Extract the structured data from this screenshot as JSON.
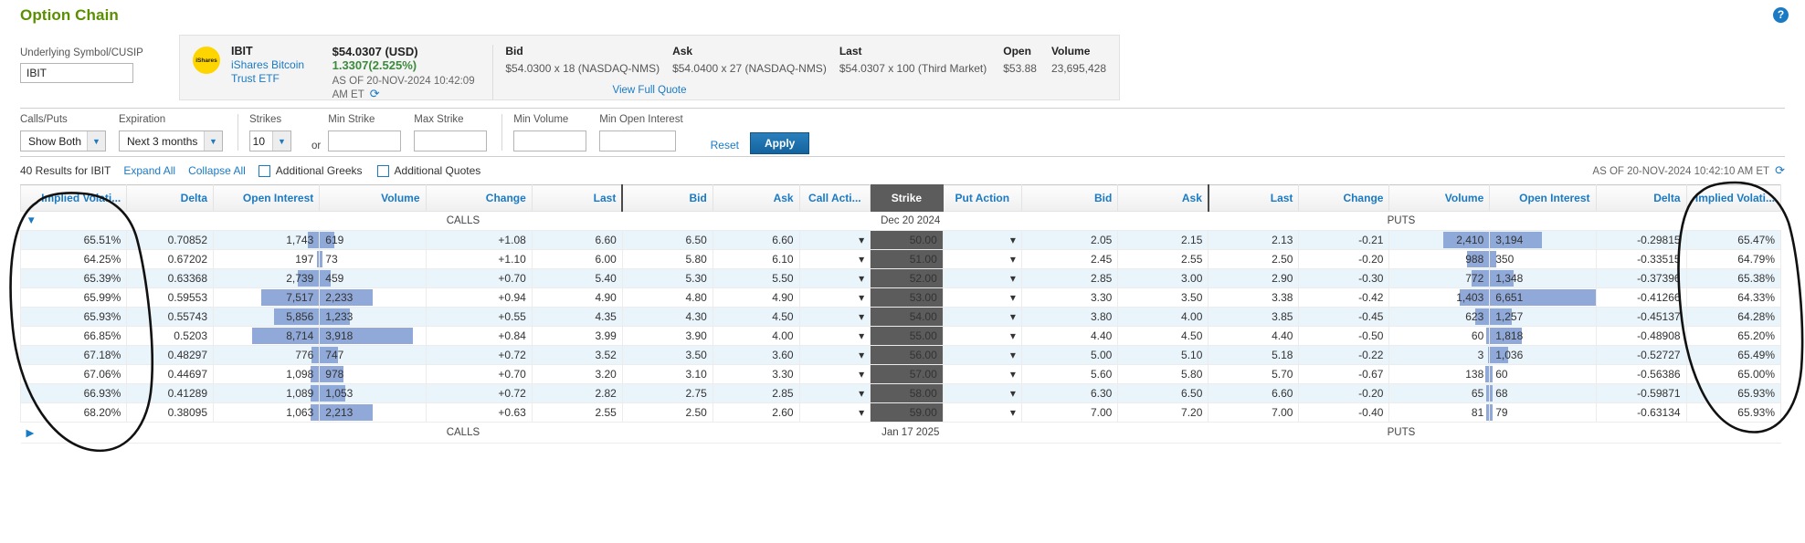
{
  "header": {
    "title": "Option Chain",
    "help_icon": "question-mark-icon"
  },
  "symbol": {
    "label": "Underlying Symbol/CUSIP",
    "value": "IBIT",
    "placeholder": ""
  },
  "quote": {
    "logo_text": "iShares",
    "ticker": "IBIT",
    "description": "iShares Bitcoin Trust ETF",
    "price": "$54.0307 (USD)",
    "change": "1.3307(2.525%)",
    "as_of": "AS OF 20-NOV-2024  10:42:09 AM ET",
    "refresh_icon": "refresh-icon",
    "bid_label": "Bid",
    "bid_value": "$54.0300 x 18 (NASDAQ-NMS)",
    "ask_label": "Ask",
    "ask_value": "$54.0400 x 27 (NASDAQ-NMS)",
    "last_label": "Last",
    "last_value": "$54.0307 x 100 (Third Market)",
    "open_label": "Open",
    "open_value": "$53.88",
    "volume_label": "Volume",
    "volume_value": "23,695,428",
    "full_quote_link": "View Full Quote"
  },
  "filters": {
    "calls_puts_label": "Calls/Puts",
    "calls_puts_value": "Show Both",
    "expiration_label": "Expiration",
    "expiration_value": "Next 3 months",
    "strikes_label": "Strikes",
    "strikes_value": "10",
    "or_text": "or",
    "min_strike_label": "Min Strike",
    "min_strike_value": "",
    "max_strike_label": "Max Strike",
    "max_strike_value": "",
    "min_volume_label": "Min Volume",
    "min_volume_value": "",
    "min_open_interest_label": "Min Open Interest",
    "min_open_interest_value": "",
    "reset_label": "Reset",
    "apply_label": "Apply"
  },
  "results": {
    "count_text": "40 Results for IBIT",
    "expand_all": "Expand All",
    "collapse_all": "Collapse All",
    "additional_greeks": "Additional Greeks",
    "additional_quotes": "Additional Quotes",
    "as_of": "AS OF 20-NOV-2024  10:42:10 AM ET",
    "refresh_icon": "refresh-icon"
  },
  "table": {
    "columns": [
      "Implied Volati...",
      "Delta",
      "Open Interest",
      "Volume",
      "Change",
      "Last",
      "Bid",
      "Ask",
      "Call Acti...",
      "Strike",
      "Put Action",
      "Bid",
      "Ask",
      "Last",
      "Change",
      "Volume",
      "Open Interest",
      "Delta",
      "Implied Volati..."
    ],
    "groups": [
      {
        "twisty": "collapse-triangle-icon",
        "calls_label": "CALLS",
        "expiration": "Dec 20 2024",
        "puts_label": "PUTS",
        "expanded": true
      },
      {
        "twisty": "expand-triangle-icon",
        "calls_label": "CALLS",
        "expiration": "Jan 17 2025",
        "puts_label": "PUTS",
        "expanded": false
      }
    ],
    "rows": [
      {
        "c_iv": "65.51%",
        "c_delta": "0.70852",
        "c_oi": "1,743",
        "c_vol": "619",
        "c_chg": "+1.08",
        "c_last": "6.60",
        "c_bid": "6.50",
        "c_ask": "6.60",
        "strike": "50.00",
        "p_bid": "2.05",
        "p_ask": "2.15",
        "p_last": "2.13",
        "p_chg": "-0.21",
        "p_vol": "2,410",
        "p_oi": "3,194",
        "p_delta": "-0.29815",
        "p_iv": "65.47%",
        "c_oi_bar": 11,
        "c_vol_bar": 14,
        "p_vol_bar": 46,
        "p_oi_bar": 49
      },
      {
        "c_iv": "64.25%",
        "c_delta": "0.67202",
        "c_oi": "197",
        "c_vol": "73",
        "c_chg": "+1.10",
        "c_last": "6.00",
        "c_bid": "5.80",
        "c_ask": "6.10",
        "strike": "51.00",
        "p_bid": "2.45",
        "p_ask": "2.55",
        "p_last": "2.50",
        "p_chg": "-0.20",
        "p_vol": "988",
        "p_oi": "350",
        "p_delta": "-0.33515",
        "p_iv": "64.79%",
        "c_oi_bar": 2,
        "c_vol_bar": 2,
        "p_vol_bar": 22,
        "p_oi_bar": 6
      },
      {
        "c_iv": "65.39%",
        "c_delta": "0.63368",
        "c_oi": "2,739",
        "c_vol": "459",
        "c_chg": "+0.70",
        "c_last": "5.40",
        "c_bid": "5.30",
        "c_ask": "5.50",
        "strike": "52.00",
        "p_bid": "2.85",
        "p_ask": "3.00",
        "p_last": "2.90",
        "p_chg": "-0.30",
        "p_vol": "772",
        "p_oi": "1,348",
        "p_delta": "-0.37396",
        "p_iv": "65.38%",
        "c_oi_bar": 20,
        "c_vol_bar": 10,
        "p_vol_bar": 18,
        "p_oi_bar": 22
      },
      {
        "c_iv": "65.99%",
        "c_delta": "0.59553",
        "c_oi": "7,517",
        "c_vol": "2,233",
        "c_chg": "+0.94",
        "c_last": "4.90",
        "c_bid": "4.80",
        "c_ask": "4.90",
        "strike": "53.00",
        "p_bid": "3.30",
        "p_ask": "3.50",
        "p_last": "3.38",
        "p_chg": "-0.42",
        "p_vol": "1,403",
        "p_oi": "6,651",
        "p_delta": "-0.41266",
        "p_iv": "64.33%",
        "c_oi_bar": 55,
        "c_vol_bar": 50,
        "p_vol_bar": 30,
        "p_oi_bar": 100
      },
      {
        "c_iv": "65.93%",
        "c_delta": "0.55743",
        "c_oi": "5,856",
        "c_vol": "1,233",
        "c_chg": "+0.55",
        "c_last": "4.35",
        "c_bid": "4.30",
        "c_ask": "4.50",
        "strike": "54.00",
        "p_bid": "3.80",
        "p_ask": "4.00",
        "p_last": "3.85",
        "p_chg": "-0.45",
        "p_vol": "623",
        "p_oi": "1,257",
        "p_delta": "-0.45137",
        "p_iv": "64.28%",
        "c_oi_bar": 43,
        "c_vol_bar": 28,
        "p_vol_bar": 14,
        "p_oi_bar": 21
      },
      {
        "c_iv": "66.85%",
        "c_delta": "0.5203",
        "c_oi": "8,714",
        "c_vol": "3,918",
        "c_chg": "+0.84",
        "c_last": "3.99",
        "c_bid": "3.90",
        "c_ask": "4.00",
        "strike": "55.00",
        "p_bid": "4.40",
        "p_ask": "4.50",
        "p_last": "4.40",
        "p_chg": "-0.50",
        "p_vol": "60",
        "p_oi": "1,818",
        "p_delta": "-0.48908",
        "p_iv": "65.20%",
        "c_oi_bar": 64,
        "c_vol_bar": 88,
        "p_vol_bar": 3,
        "p_oi_bar": 30
      },
      {
        "c_iv": "67.18%",
        "c_delta": "0.48297",
        "c_oi": "776",
        "c_vol": "747",
        "c_chg": "+0.72",
        "c_last": "3.52",
        "c_bid": "3.50",
        "c_ask": "3.60",
        "strike": "56.00",
        "p_bid": "5.00",
        "p_ask": "5.10",
        "p_last": "5.18",
        "p_chg": "-0.22",
        "p_vol": "3",
        "p_oi": "1,036",
        "p_delta": "-0.52727",
        "p_iv": "65.49%",
        "c_oi_bar": 7,
        "c_vol_bar": 17,
        "p_vol_bar": 1,
        "p_oi_bar": 17
      },
      {
        "c_iv": "67.06%",
        "c_delta": "0.44697",
        "c_oi": "1,098",
        "c_vol": "978",
        "c_chg": "+0.70",
        "c_last": "3.20",
        "c_bid": "3.10",
        "c_ask": "3.30",
        "strike": "57.00",
        "p_bid": "5.60",
        "p_ask": "5.80",
        "p_last": "5.70",
        "p_chg": "-0.67",
        "p_vol": "138",
        "p_oi": "60",
        "p_delta": "-0.56386",
        "p_iv": "65.00%",
        "c_oi_bar": 8,
        "c_vol_bar": 22,
        "p_vol_bar": 4,
        "p_oi_bar": 2
      },
      {
        "c_iv": "66.93%",
        "c_delta": "0.41289",
        "c_oi": "1,089",
        "c_vol": "1,053",
        "c_chg": "+0.72",
        "c_last": "2.82",
        "c_bid": "2.75",
        "c_ask": "2.85",
        "strike": "58.00",
        "p_bid": "6.30",
        "p_ask": "6.50",
        "p_last": "6.60",
        "p_chg": "-0.20",
        "p_vol": "65",
        "p_oi": "68",
        "p_delta": "-0.59871",
        "p_iv": "65.93%",
        "c_oi_bar": 8,
        "c_vol_bar": 24,
        "p_vol_bar": 3,
        "p_oi_bar": 2
      },
      {
        "c_iv": "68.20%",
        "c_delta": "0.38095",
        "c_oi": "1,063",
        "c_vol": "2,213",
        "c_chg": "+0.63",
        "c_last": "2.55",
        "c_bid": "2.50",
        "c_ask": "2.60",
        "strike": "59.00",
        "p_bid": "7.00",
        "p_ask": "7.20",
        "p_last": "7.00",
        "p_chg": "-0.40",
        "p_vol": "81",
        "p_oi": "79",
        "p_delta": "-0.63134",
        "p_iv": "65.93%",
        "c_oi_bar": 8,
        "c_vol_bar": 50,
        "p_vol_bar": 3,
        "p_oi_bar": 2
      }
    ]
  },
  "annotations": {
    "left_oval": "hand-drawn-oval-left",
    "right_oval": "hand-drawn-oval-right"
  }
}
